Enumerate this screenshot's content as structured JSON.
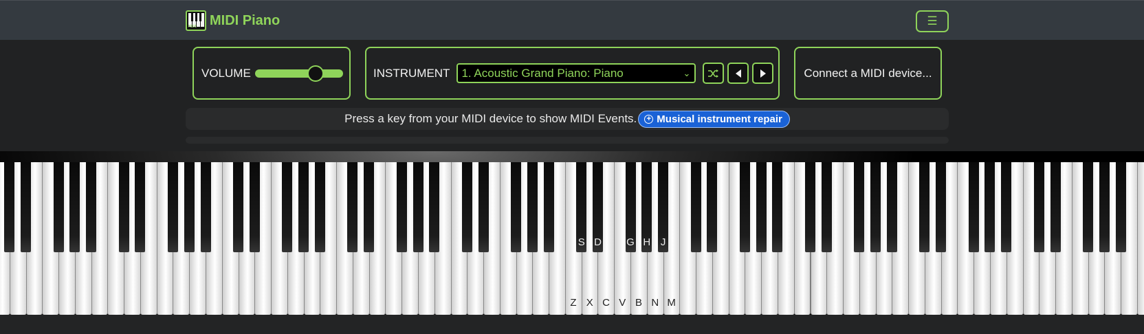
{
  "app": {
    "brand_name": "MIDI Piano",
    "logo_text": "MIDI"
  },
  "header": {
    "menu_icon": "hamburger-icon"
  },
  "volume": {
    "label": "VOLUME",
    "level_fraction": 0.73
  },
  "instrument": {
    "label": "INSTRUMENT",
    "selected": "1. Acoustic Grand Piano: Piano",
    "buttons": [
      "shuffle-icon",
      "previous-icon",
      "next-icon"
    ]
  },
  "midi": {
    "connect_label": "Connect a MIDI device..."
  },
  "message": {
    "text": "Press a key from your MIDI device to show MIDI Events.",
    "ad_label": "Musical instrument repair",
    "ad_icon": "plus-circle-icon"
  },
  "piano": {
    "white_key_labels": [
      "Z",
      "X",
      "C",
      "V",
      "B",
      "N",
      "M"
    ],
    "black_key_labels": [
      "S",
      "D",
      "G",
      "H",
      "J"
    ]
  },
  "colors": {
    "accent": "#8fd45a",
    "background": "#212223",
    "navbar": "#343a40",
    "ad_blue": "#1a62d6"
  }
}
